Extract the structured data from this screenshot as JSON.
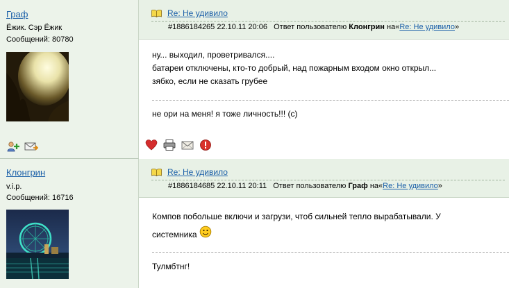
{
  "posts": [
    {
      "user": {
        "name": "Граф",
        "rank": "Ёжик. Сэр Ёжик",
        "posts_count": "Сообщений: 80780"
      },
      "title": "Re: Не удивило",
      "meta": {
        "id_date": "#1886184265 22.10.11 20:06",
        "reply_label": "Ответ пользователю",
        "reply_user": "Клонгрин",
        "on": "на",
        "quote_open": "«",
        "ref_title": "Re: Не удивило",
        "quote_close": "»"
      },
      "body": [
        "ну... выходил, проветривался....",
        "батареи отключены, кто-то добрый, над пожарным входом окно открыл...",
        "зябко, если не сказать грубее"
      ],
      "signature": "не ори на меня! я тоже личность!!! (с)"
    },
    {
      "user": {
        "name": "Клонгрин",
        "rank": "v.i.p.",
        "posts_count": "Сообщений: 16716"
      },
      "title": "Re: Не удивило",
      "meta": {
        "id_date": "#1886184685 22.10.11 20:11",
        "reply_label": "Ответ пользователю",
        "reply_user": "Граф",
        "on": "на",
        "quote_open": "«",
        "ref_title": "Re: Не удивило",
        "quote_close": "»"
      },
      "body": [
        "Компов побольше включи и загрузи, чтоб сильней тепло вырабатывали. У",
        "системника"
      ],
      "signature": "Тулмбтнг!"
    }
  ],
  "colors": {
    "link": "#1a5fa8",
    "sidebar_bg": "#ecf3ea",
    "header_bg": "#e8f1e6"
  }
}
